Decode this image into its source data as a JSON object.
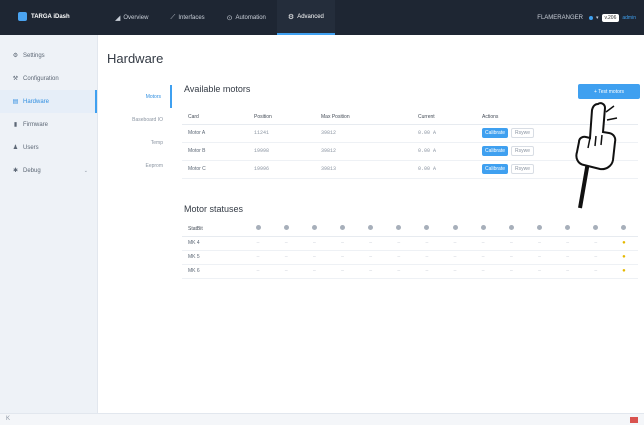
{
  "brand": {
    "name": "TARGA iDash"
  },
  "nav": [
    {
      "icon": "◢",
      "label": "Overview"
    },
    {
      "icon": "⟋",
      "label": "Interfaces"
    },
    {
      "icon": "⊙",
      "label": "Automation"
    },
    {
      "icon": "⚙",
      "label": "Advanced"
    }
  ],
  "topright": {
    "device": "FLAMERANGER",
    "version": "v.206",
    "user": "admin"
  },
  "sidebar": [
    {
      "icon": "⚙",
      "label": "Settings"
    },
    {
      "icon": "⚒",
      "label": "Configuration"
    },
    {
      "icon": "▤",
      "label": "Hardware"
    },
    {
      "icon": "▮",
      "label": "Firmware"
    },
    {
      "icon": "♟",
      "label": "Users"
    },
    {
      "icon": "✱",
      "label": "Debug"
    }
  ],
  "page": {
    "title": "Hardware"
  },
  "subnav": [
    "Motors",
    "Baseboard IO",
    "Temp",
    "Eeprom"
  ],
  "motors": {
    "title": "Available motors",
    "action_label": "+ Test motors",
    "columns": [
      "Card",
      "Position",
      "Max Position",
      "Current",
      "Actions"
    ],
    "rows": [
      {
        "card": "Motor A",
        "position": "11241",
        "max": "39812",
        "current": "0.00 A"
      },
      {
        "card": "Motor B",
        "position": "19998",
        "max": "39812",
        "current": "0.00 A"
      },
      {
        "card": "Motor C",
        "position": "19996",
        "max": "39813",
        "current": "0.00 A"
      }
    ],
    "calibrate_label": "Calibrate",
    "remove_label": "Rsywe"
  },
  "statuses": {
    "title": "Motor statuses",
    "first_col": "StatBit",
    "bit_count": 14,
    "rows": [
      "MK 4",
      "MK 5",
      "MK 6"
    ]
  },
  "colors": {
    "accent": "#3fa0f0",
    "topbar": "#1e2633",
    "sidebar": "#eef2f7",
    "status_on": "#e5b800"
  }
}
